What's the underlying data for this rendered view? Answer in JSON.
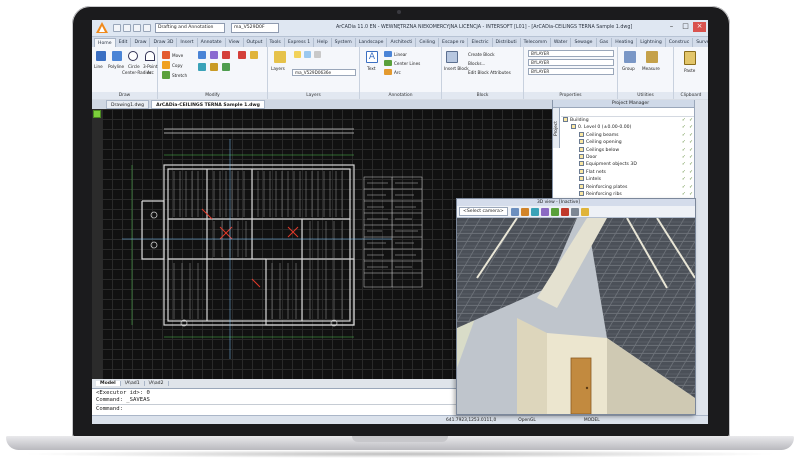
{
  "app": {
    "title": "ArCADia 11.0 EN - WEWNĘTRZNA NIEKOMERCYJNA LICENCJA - INTERSOFT [L01] - [ArCADia-CEILINGS TERNA Sample 1.dwg]",
    "workspace": "Drafting and Annotation",
    "layer_combo": "ma_V529D0F",
    "window_controls": [
      "minimize-icon",
      "maximize-icon",
      "close-icon"
    ]
  },
  "ribbon": {
    "tabs": [
      "Home",
      "Edit",
      "Draw",
      "Draw 3D",
      "Insert",
      "Annotate",
      "View",
      "Output",
      "Tools",
      "Express 1",
      "Help",
      "System",
      "Landscape",
      "Architecti",
      "Ceiling",
      "Escape ro",
      "Electric",
      "Distributi",
      "Telecomm",
      "Water",
      "Sewage",
      "Gas",
      "Heating",
      "Lightning",
      "Construc",
      "Surveyor"
    ],
    "active_tab": "Home",
    "groups": {
      "draw": {
        "label": "Draw",
        "buttons": [
          "Line",
          "Polyline",
          "Circle",
          "Center-Radius",
          "3-Point",
          "Arc"
        ]
      },
      "modify": {
        "label": "Modify",
        "buttons": [
          "Move",
          "Copy",
          "Stretch"
        ]
      },
      "layers": {
        "label": "Layers",
        "buttons": [
          "Layers"
        ],
        "combo": "ma_V529D0636e"
      },
      "annotation": {
        "label": "Annotation",
        "buttons": [
          "Text",
          "Linear",
          "Center Lines",
          "Arc"
        ]
      },
      "block": {
        "label": "Block",
        "buttons": [
          "Insert Block",
          "Create Block",
          "Blocks...",
          "Edit Block Attributes"
        ]
      },
      "properties": {
        "label": "Properties",
        "fields": [
          "BYLAYER",
          "BYLAYER",
          "BYLAYER"
        ]
      },
      "utilities": {
        "label": "Utilities",
        "buttons": [
          "Group",
          "Measure"
        ]
      },
      "clipboard": {
        "label": "Clipboard",
        "buttons": [
          "Paste"
        ]
      }
    }
  },
  "documents": {
    "tabs": [
      "Drawing1.dwg",
      "ArCADia-CEILINGS TERNA Sample 1.dwg"
    ],
    "active": "ArCADia-CEILINGS TERNA Sample 1.dwg"
  },
  "layout_tabs": [
    "Model",
    "\\A\\ad1",
    "\\A\\ad2"
  ],
  "command_line": {
    "history": [
      "<Executor id>: 0",
      "Command: _SAVEAS"
    ],
    "prompt": "Command:"
  },
  "status_bar": {
    "coords": "641.7923,1253.0111,0",
    "renderer": "OpenGL",
    "space": "MODEL"
  },
  "project_manager": {
    "title": "Project Manager",
    "side_tab": "Project",
    "tree": [
      {
        "label": "Building",
        "level": 0
      },
      {
        "label": "0. Level 0 (±0.00-0.00)",
        "level": 1
      },
      {
        "label": "Ceiling beams",
        "level": 2
      },
      {
        "label": "Ceiling opening",
        "level": 2
      },
      {
        "label": "Ceilings below",
        "level": 2
      },
      {
        "label": "Door",
        "level": 2
      },
      {
        "label": "Equipment objects 3D",
        "level": 2
      },
      {
        "label": "Flat nets",
        "level": 2
      },
      {
        "label": "Lintels",
        "level": 2
      },
      {
        "label": "Reinforcing plates",
        "level": 2
      },
      {
        "label": "Reinforcing ribs",
        "level": 2
      }
    ]
  },
  "view3d": {
    "title": "3D view - [Inactive]",
    "camera": "<Select camera>"
  },
  "colors": {
    "canvas_bg": "#111111",
    "accent_green": "#7ccf3b",
    "ribbon_bg": "#f5f7fb",
    "close_red": "#d9534f"
  }
}
